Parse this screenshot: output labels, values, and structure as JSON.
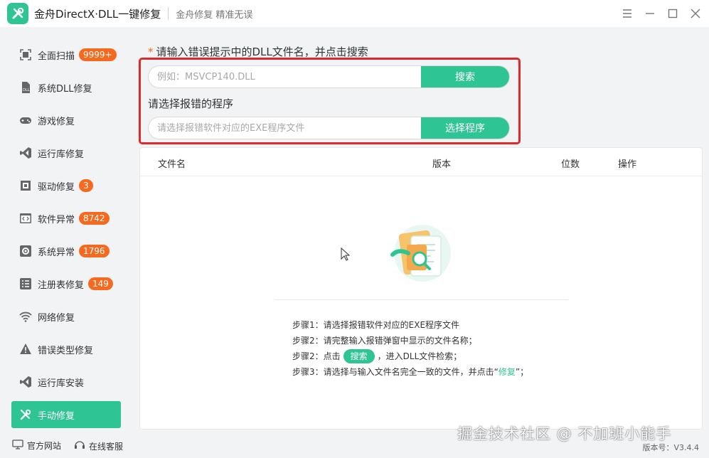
{
  "titlebar": {
    "app_title": "金舟DirectX·DLL一键修复",
    "slogan": "金舟修复 精准无误"
  },
  "sidebar": {
    "items": [
      {
        "label": "全面扫描",
        "badge": "9999+",
        "icon": "scan-icon"
      },
      {
        "label": "系统DLL修复",
        "badge": "",
        "icon": "dll-file-icon"
      },
      {
        "label": "游戏修复",
        "badge": "",
        "icon": "gamepad-icon"
      },
      {
        "label": "运行库修复",
        "badge": "",
        "icon": "visual-studio-icon"
      },
      {
        "label": "驱动修复",
        "badge": "3",
        "icon": "driver-icon"
      },
      {
        "label": "软件异常",
        "badge": "8742",
        "icon": "code-window-icon"
      },
      {
        "label": "系统异常",
        "badge": "1796",
        "icon": "gear-icon"
      },
      {
        "label": "注册表修复",
        "badge": "149",
        "icon": "list-icon"
      },
      {
        "label": "网络修复",
        "badge": "",
        "icon": "wifi-icon"
      },
      {
        "label": "错误类型修复",
        "badge": "",
        "icon": "warning-icon"
      },
      {
        "label": "运行库安装",
        "badge": "",
        "icon": "runtime-install-icon"
      },
      {
        "label": "手动修复",
        "badge": "",
        "icon": "tools-icon"
      }
    ]
  },
  "search": {
    "prompt_star": "*",
    "prompt": "请输入错误提示中的DLL文件名，并点击搜索",
    "dll_placeholder": "例如：MSVCP140.DLL",
    "search_button": "搜索",
    "program_label": "请选择报错的程序",
    "program_placeholder": "请选择报错软件对应的EXE程序文件",
    "select_button": "选择程序"
  },
  "table": {
    "headers": [
      "文件名",
      "版本",
      "位数",
      "操作"
    ]
  },
  "steps": {
    "step1": "步骤1：请选择报错软件对应的EXE程序文件",
    "step2a": "步骤2：请完整输入报错弹窗中显示的文件名称；",
    "step2b_prefix": "步骤2：点击",
    "step2b_button": "搜索",
    "step2b_suffix": "，进入DLL文件检索；",
    "step3_prefix": "步骤3：请选择与输入文件名完全一致的文件，并点击",
    "step3_quote_open": "“",
    "step3_word": "修复",
    "step3_suffix": "”；"
  },
  "footer": {
    "website": "官方网站",
    "support": "在线客服",
    "version": "版本号：V3.4.4"
  },
  "watermark": "掘金技术社区 @ 不加班小能手",
  "colors": {
    "accent": "#2fc494",
    "badge": "#f56a1f",
    "highlight_box": "#e02a2a"
  }
}
